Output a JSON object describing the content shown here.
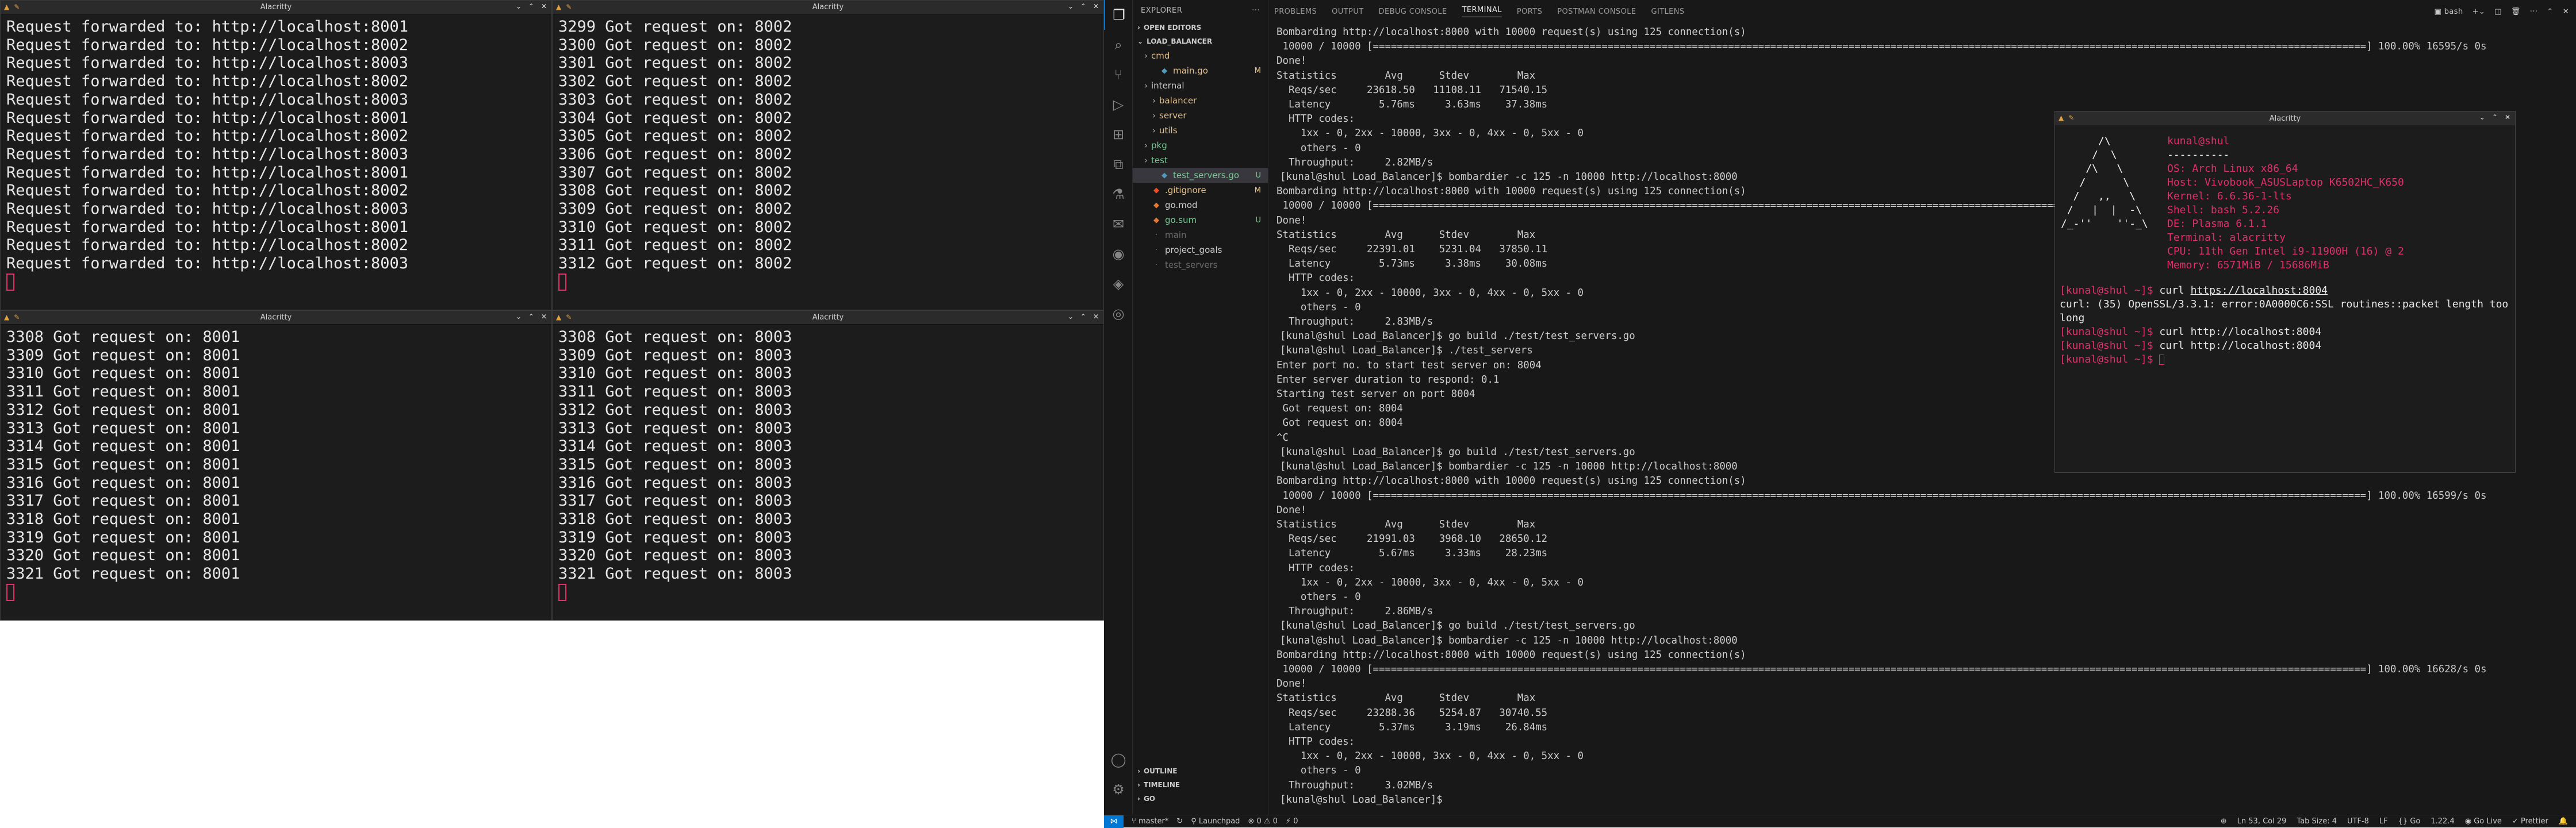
{
  "alacritty_title": "Alacritty",
  "pane_tl": {
    "lines": [
      "Request forwarded to: http://localhost:8001",
      "Request forwarded to: http://localhost:8002",
      "Request forwarded to: http://localhost:8003",
      "Request forwarded to: http://localhost:8002",
      "Request forwarded to: http://localhost:8003",
      "Request forwarded to: http://localhost:8001",
      "Request forwarded to: http://localhost:8002",
      "Request forwarded to: http://localhost:8003",
      "Request forwarded to: http://localhost:8001",
      "Request forwarded to: http://localhost:8002",
      "Request forwarded to: http://localhost:8003",
      "Request forwarded to: http://localhost:8001",
      "Request forwarded to: http://localhost:8002",
      "Request forwarded to: http://localhost:8003"
    ]
  },
  "pane_tr": {
    "lines": [
      "3299 Got request on: 8002",
      "3300 Got request on: 8002",
      "3301 Got request on: 8002",
      "3302 Got request on: 8002",
      "3303 Got request on: 8002",
      "3304 Got request on: 8002",
      "3305 Got request on: 8002",
      "3306 Got request on: 8002",
      "3307 Got request on: 8002",
      "3308 Got request on: 8002",
      "3309 Got request on: 8002",
      "3310 Got request on: 8002",
      "3311 Got request on: 8002",
      "3312 Got request on: 8002"
    ]
  },
  "pane_bl": {
    "lines": [
      "3308 Got request on: 8001",
      "3309 Got request on: 8001",
      "3310 Got request on: 8001",
      "3311 Got request on: 8001",
      "3312 Got request on: 8001",
      "3313 Got request on: 8001",
      "3314 Got request on: 8001",
      "3315 Got request on: 8001",
      "3316 Got request on: 8001",
      "3317 Got request on: 8001",
      "3318 Got request on: 8001",
      "3319 Got request on: 8001",
      "3320 Got request on: 8001",
      "3321 Got request on: 8001"
    ]
  },
  "pane_br": {
    "lines": [
      "3308 Got request on: 8003",
      "3309 Got request on: 8003",
      "3310 Got request on: 8003",
      "3311 Got request on: 8003",
      "3312 Got request on: 8003",
      "3313 Got request on: 8003",
      "3314 Got request on: 8003",
      "3315 Got request on: 8003",
      "3316 Got request on: 8003",
      "3317 Got request on: 8003",
      "3318 Got request on: 8003",
      "3319 Got request on: 8003",
      "3320 Got request on: 8003",
      "3321 Got request on: 8003"
    ]
  },
  "vscode": {
    "explorer_title": "EXPLORER",
    "open_editors": "OPEN EDITORS",
    "project": "LOAD_BALANCER",
    "tree": [
      {
        "label": "cmd",
        "indent": 1,
        "kind": "folder",
        "color": "#e2c08d",
        "badge": "",
        "badge_color": "#e2c08d"
      },
      {
        "label": "main.go",
        "indent": 2,
        "kind": "go",
        "color": "#e2c08d",
        "badge": "M",
        "badge_color": "#e2c08d"
      },
      {
        "label": "internal",
        "indent": 1,
        "kind": "folder",
        "color": "#cccccc",
        "badge": "",
        "badge_color": "#73c991"
      },
      {
        "label": "balancer",
        "indent": 2,
        "kind": "folder",
        "color": "#e2c08d",
        "badge": "",
        "badge_color": "#e2c08d"
      },
      {
        "label": "server",
        "indent": 2,
        "kind": "folder",
        "color": "#e2c08d",
        "badge": "",
        "badge_color": "#e2c08d"
      },
      {
        "label": "utils",
        "indent": 2,
        "kind": "folder",
        "color": "#e2c08d",
        "badge": "",
        "badge_color": "#e2c08d"
      },
      {
        "label": "pkg",
        "indent": 1,
        "kind": "folder",
        "color": "#73c991",
        "badge": "",
        "badge_color": "#73c991"
      },
      {
        "label": "test",
        "indent": 1,
        "kind": "folder",
        "color": "#73c991",
        "badge": "",
        "badge_color": "#73c991"
      },
      {
        "label": "test_servers.go",
        "indent": 2,
        "kind": "go",
        "color": "#73c991",
        "badge": "U",
        "badge_color": "#73c991",
        "selected": true
      },
      {
        "label": ".gitignore",
        "indent": 1,
        "kind": "git",
        "color": "#e2c08d",
        "badge": "M",
        "badge_color": "#e2c08d"
      },
      {
        "label": "go.mod",
        "indent": 1,
        "kind": "mod",
        "color": "#cccccc",
        "badge": "",
        "badge_color": "#cccccc"
      },
      {
        "label": "go.sum",
        "indent": 1,
        "kind": "mod",
        "color": "#73c991",
        "badge": "U",
        "badge_color": "#73c991"
      },
      {
        "label": "main",
        "indent": 1,
        "kind": "file",
        "color": "#6b6b6b",
        "badge": "",
        "badge_color": "#6b6b6b"
      },
      {
        "label": "project_goals",
        "indent": 1,
        "kind": "file",
        "color": "#cccccc",
        "badge": "",
        "badge_color": "#cccccc"
      },
      {
        "label": "test_servers",
        "indent": 1,
        "kind": "file",
        "color": "#6b6b6b",
        "badge": "",
        "badge_color": "#6b6b6b"
      }
    ],
    "bottom_sections": [
      "OUTLINE",
      "TIMELINE",
      "GO"
    ],
    "panel_tabs": [
      "PROBLEMS",
      "OUTPUT",
      "DEBUG CONSOLE",
      "TERMINAL",
      "PORTS",
      "POSTMAN CONSOLE",
      "GITLENS"
    ],
    "active_tab": "TERMINAL",
    "terminal_shell": "bash",
    "terminal_lines": [
      {
        "t": "Bombarding http://localhost:8000 with 10000 request(s) using 125 connection(s)",
        "dot": ""
      },
      {
        "t": " 10000 / 10000 [=====================================================================================================================================================================] 100.00% 16595/s 0s",
        "dot": ""
      },
      {
        "t": "Done!",
        "dot": ""
      },
      {
        "t": "Statistics        Avg      Stdev        Max",
        "dot": ""
      },
      {
        "t": "  Reqs/sec     23618.50   11108.11   71540.15",
        "dot": ""
      },
      {
        "t": "  Latency        5.76ms     3.63ms    37.38ms",
        "dot": ""
      },
      {
        "t": "  HTTP codes:",
        "dot": ""
      },
      {
        "t": "    1xx - 0, 2xx - 10000, 3xx - 0, 4xx - 0, 5xx - 0",
        "dot": ""
      },
      {
        "t": "    others - 0",
        "dot": ""
      },
      {
        "t": "  Throughput:     2.82MB/s",
        "dot": ""
      },
      {
        "t": "[kunal@shul Load_Balancer]$ bombardier -c 125 -n 10000 http://localhost:8000",
        "dot": "blue"
      },
      {
        "t": "Bombarding http://localhost:8000 with 10000 request(s) using 125 connection(s)",
        "dot": ""
      },
      {
        "t": " 10000 / 10000 [=====================================================================================================================================================================] 100.00% 16558/s 0s",
        "dot": ""
      },
      {
        "t": "Done!",
        "dot": ""
      },
      {
        "t": "Statistics        Avg      Stdev        Max",
        "dot": ""
      },
      {
        "t": "  Reqs/sec     22391.01    5231.04   37850.11",
        "dot": ""
      },
      {
        "t": "  Latency        5.73ms     3.38ms    30.08ms",
        "dot": ""
      },
      {
        "t": "  HTTP codes:",
        "dot": ""
      },
      {
        "t": "    1xx - 0, 2xx - 10000, 3xx - 0, 4xx - 0, 5xx - 0",
        "dot": ""
      },
      {
        "t": "    others - 0",
        "dot": ""
      },
      {
        "t": "  Throughput:     2.83MB/s",
        "dot": ""
      },
      {
        "t": "[kunal@shul Load_Balancer]$ go build ./test/test_servers.go",
        "dot": "blue"
      },
      {
        "t": "[kunal@shul Load_Balancer]$ ./test_servers",
        "dot": "red"
      },
      {
        "t": "Enter port no. to start test server on: 8004",
        "dot": ""
      },
      {
        "t": "Enter server duration to respond: 0.1",
        "dot": ""
      },
      {
        "t": "Starting test server on port 8004",
        "dot": ""
      },
      {
        "t": " Got request on: 8004",
        "dot": ""
      },
      {
        "t": " Got request on: 8004",
        "dot": ""
      },
      {
        "t": "^C",
        "dot": ""
      },
      {
        "t": "[kunal@shul Load_Balancer]$ go build ./test/test_servers.go",
        "dot": "blue"
      },
      {
        "t": "[kunal@shul Load_Balancer]$ bombardier -c 125 -n 10000 http://localhost:8000",
        "dot": "blue"
      },
      {
        "t": "Bombarding http://localhost:8000 with 10000 request(s) using 125 connection(s)",
        "dot": ""
      },
      {
        "t": " 10000 / 10000 [=====================================================================================================================================================================] 100.00% 16599/s 0s",
        "dot": ""
      },
      {
        "t": "Done!",
        "dot": ""
      },
      {
        "t": "Statistics        Avg      Stdev        Max",
        "dot": ""
      },
      {
        "t": "  Reqs/sec     21991.03    3968.10   28650.12",
        "dot": ""
      },
      {
        "t": "  Latency        5.67ms     3.33ms    28.23ms",
        "dot": ""
      },
      {
        "t": "  HTTP codes:",
        "dot": ""
      },
      {
        "t": "    1xx - 0, 2xx - 10000, 3xx - 0, 4xx - 0, 5xx - 0",
        "dot": ""
      },
      {
        "t": "    others - 0",
        "dot": ""
      },
      {
        "t": "  Throughput:     2.86MB/s",
        "dot": ""
      },
      {
        "t": "[kunal@shul Load_Balancer]$ go build ./test/test_servers.go",
        "dot": "blue"
      },
      {
        "t": "[kunal@shul Load_Balancer]$ bombardier -c 125 -n 10000 http://localhost:8000",
        "dot": "blue"
      },
      {
        "t": "Bombarding http://localhost:8000 with 10000 request(s) using 125 connection(s)",
        "dot": ""
      },
      {
        "t": " 10000 / 10000 [=====================================================================================================================================================================] 100.00% 16628/s 0s",
        "dot": ""
      },
      {
        "t": "Done!",
        "dot": ""
      },
      {
        "t": "Statistics        Avg      Stdev        Max",
        "dot": ""
      },
      {
        "t": "  Reqs/sec     23288.36    5254.87   30740.55",
        "dot": ""
      },
      {
        "t": "  Latency        5.37ms     3.19ms    26.84ms",
        "dot": ""
      },
      {
        "t": "  HTTP codes:",
        "dot": ""
      },
      {
        "t": "    1xx - 0, 2xx - 10000, 3xx - 0, 4xx - 0, 5xx - 0",
        "dot": ""
      },
      {
        "t": "    others - 0",
        "dot": ""
      },
      {
        "t": "  Throughput:     3.02MB/s",
        "dot": ""
      },
      {
        "t": "[kunal@shul Load_Balancer]$ ",
        "dot": "blue"
      }
    ],
    "status": {
      "branch": "master*",
      "launchpad": "Launchpad",
      "problems": "⊗ 0 ⚠ 0",
      "ports": "0",
      "position": "Ln 53, Col 29",
      "tab_size": "Tab Size: 4",
      "encoding": "UTF-8",
      "eol": "LF",
      "lang": "Go",
      "go_version": "1.22.4",
      "go_live": "Go Live",
      "prettier": "Prettier"
    }
  },
  "float": {
    "title": "Alacritty",
    "art": "      /\\\n     /  \\\n    /\\   \\\n   /      \\\n  /   ,,   \\\n /   |  |  -\\\n/_-''    ''-_\\",
    "user": "kunal@shul",
    "separator": "----------",
    "fields": [
      {
        "k": "OS",
        "v": "Arch Linux x86_64"
      },
      {
        "k": "Host",
        "v": "Vivobook_ASUSLaptop K6502HC_K650"
      },
      {
        "k": "Kernel",
        "v": "6.6.36-1-lts"
      },
      {
        "k": "Shell",
        "v": "bash 5.2.26"
      },
      {
        "k": "DE",
        "v": "Plasma 6.1.1"
      },
      {
        "k": "Terminal",
        "v": "alacritty"
      },
      {
        "k": "CPU",
        "v": "11th Gen Intel i9-11900H (16) @ 2"
      },
      {
        "k": "Memory",
        "v": "6571MiB / 15686MiB"
      }
    ],
    "prompt_lines": [
      {
        "p": "[kunal@shul ~]$ ",
        "c": "curl ",
        "u": "https://localhost:8004"
      },
      {
        "p": "",
        "c": "curl: (35) OpenSSL/3.3.1: error:0A0000C6:SSL routines::packet length too long",
        "u": ""
      },
      {
        "p": "[kunal@shul ~]$ ",
        "c": "curl http://localhost:8004",
        "u": ""
      },
      {
        "p": "[kunal@shul ~]$ ",
        "c": "curl http://localhost:8004",
        "u": ""
      },
      {
        "p": "[kunal@shul ~]$ ",
        "c": "",
        "u": ""
      }
    ]
  },
  "colors": {
    "accent": "#0078d4",
    "prompt": "#e0306a",
    "modified": "#e2c08d",
    "untracked": "#73c991"
  }
}
